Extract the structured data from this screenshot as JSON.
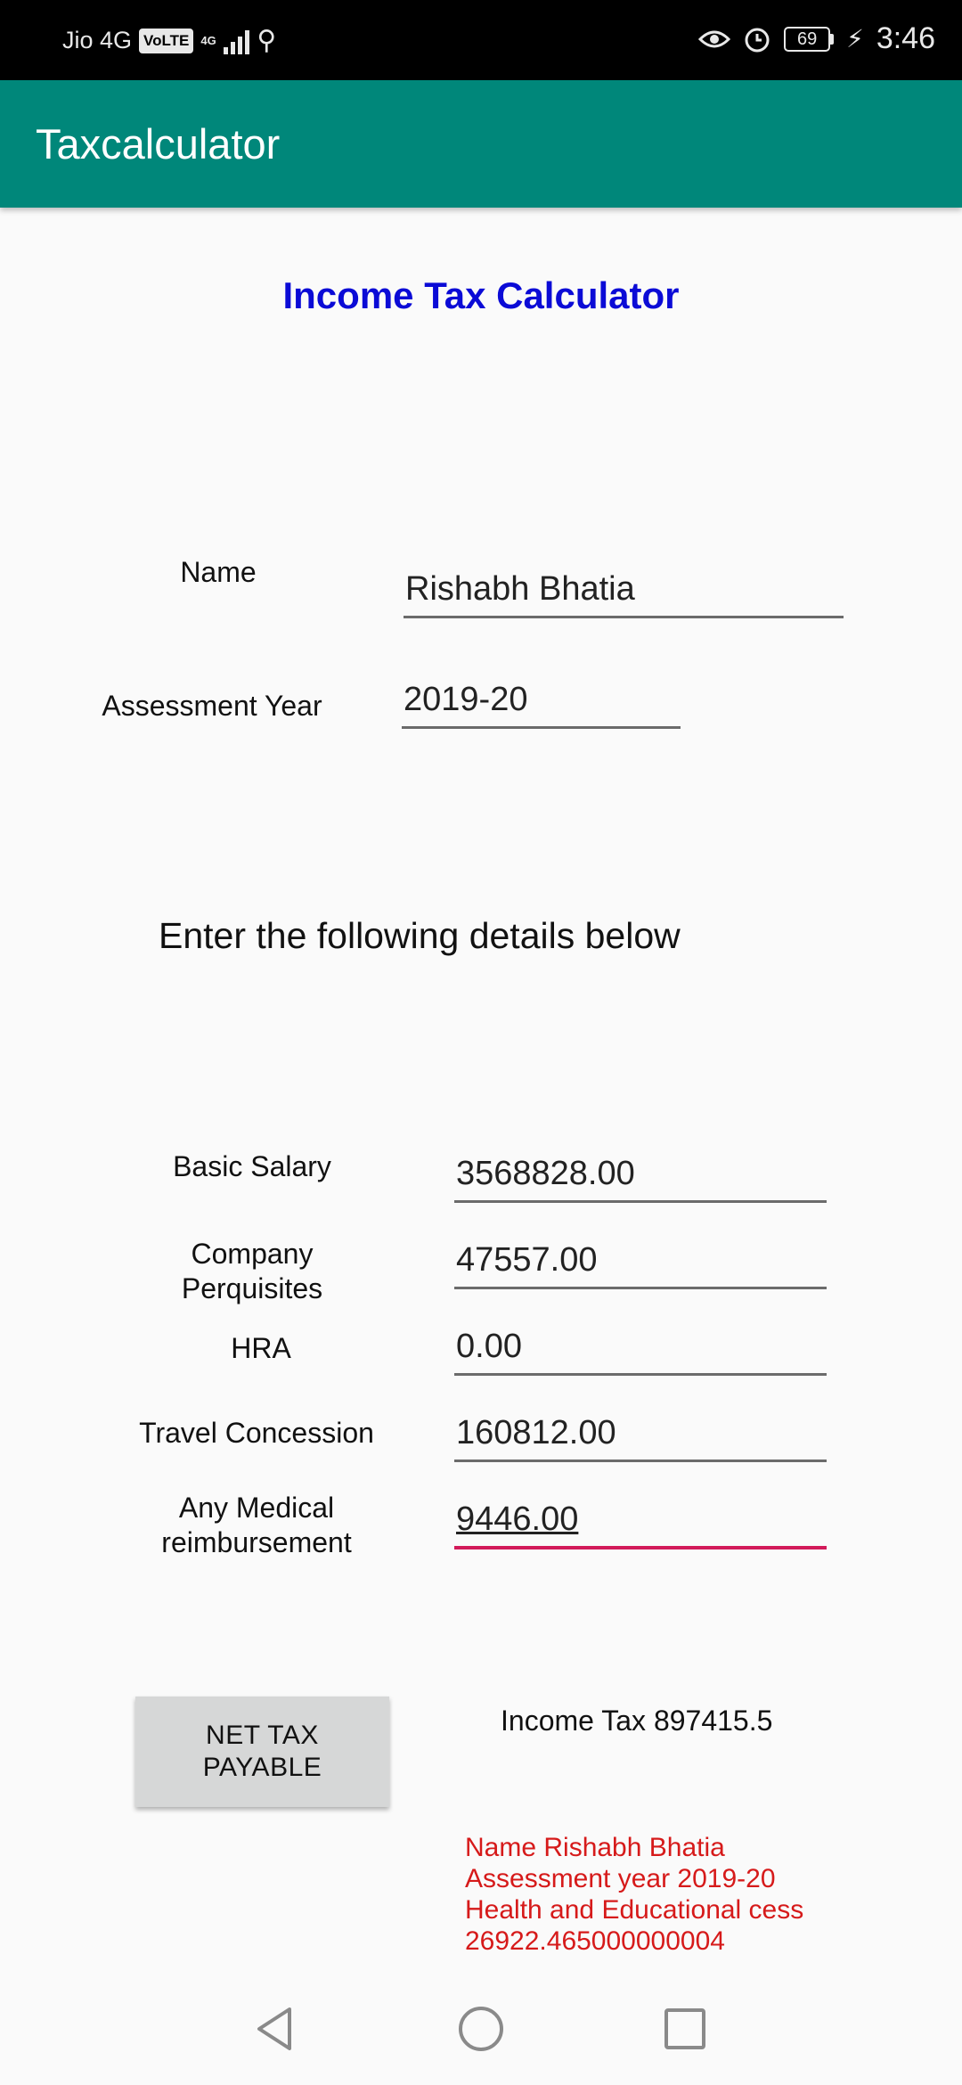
{
  "status_bar": {
    "carrier": "Jio 4G",
    "volte": "VoLTE",
    "network": "4G",
    "battery": "69",
    "time": "3:46",
    "icons": [
      "signal-icon",
      "usb-icon",
      "eye-comfort-icon",
      "alarm-icon",
      "battery-icon",
      "charging-icon"
    ]
  },
  "app_bar": {
    "title": "Taxcalculator",
    "color": "#00877a"
  },
  "page": {
    "title": "Income Tax Calculator",
    "title_color": "#0b0bd6",
    "name_label": "Name",
    "name_value": "Rishabh Bhatia",
    "year_label": "Assessment Year",
    "year_value": "2019-20",
    "section_heading": "Enter the following details below"
  },
  "details": {
    "basic_salary_label": "Basic Salary",
    "basic_salary_value": "3568828.00",
    "company_perq_label_1": "Company",
    "company_perq_label_2": "Perquisites",
    "company_perq_value": "47557.00",
    "hra_label": "HRA",
    "hra_value": "0.00",
    "travel_label": "Travel Concession",
    "travel_value": "160812.00",
    "medical_label_1": "Any Medical",
    "medical_label_2": "reimbursement",
    "medical_value": "9446.00"
  },
  "actions": {
    "net_tax_line1": "NET TAX",
    "net_tax_line2": "PAYABLE"
  },
  "results": {
    "income_tax": "Income Tax 897415.5",
    "line1": "Name Rishabh Bhatia",
    "line2": "Assessment year 2019-20",
    "line3": "Health and Educational cess",
    "line4": "26922.465000000004",
    "color": "#d61a1a"
  },
  "nav": {
    "icons": [
      "back-icon",
      "home-icon",
      "recents-icon"
    ]
  }
}
